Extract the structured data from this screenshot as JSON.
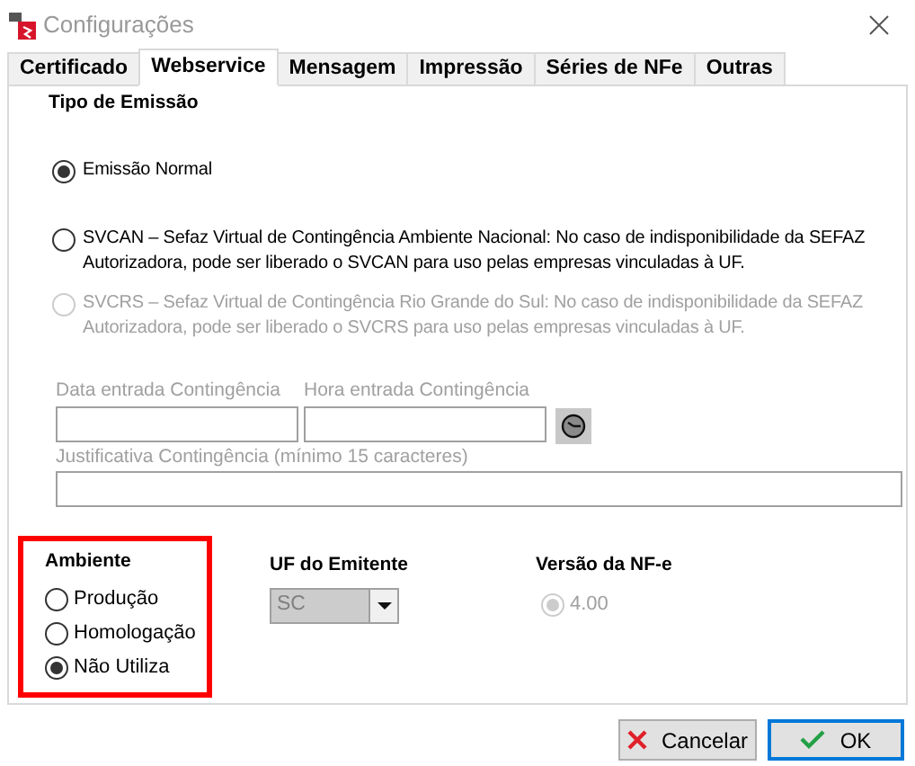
{
  "window": {
    "title": "Configurações"
  },
  "tabs": [
    {
      "label": "Certificado",
      "selected": false
    },
    {
      "label": "Webservice",
      "selected": true
    },
    {
      "label": "Mensagem",
      "selected": false
    },
    {
      "label": "Impressão",
      "selected": false
    },
    {
      "label": "Séries de NFe",
      "selected": false
    },
    {
      "label": "Outras",
      "selected": false
    }
  ],
  "tipo_emissao": {
    "title": "Tipo de Emissão",
    "options": [
      {
        "label": "Emissão Normal",
        "selected": true,
        "disabled": false
      },
      {
        "label": "SVCAN – Sefaz Virtual de Contingência Ambiente Nacional: No caso de indisponibilidade da SEFAZ Autorizadora, pode ser liberado o SVCAN para uso pelas empresas vinculadas à UF.",
        "selected": false,
        "disabled": false
      },
      {
        "label": "SVCRS – Sefaz Virtual de Contingência Rio Grande do Sul: No caso de indisponibilidade da SEFAZ Autorizadora, pode ser liberado o SVCRS para uso pelas empresas vinculadas à UF.",
        "selected": false,
        "disabled": true
      }
    ]
  },
  "contingencia": {
    "data_label": "Data entrada Contingência",
    "hora_label": "Hora entrada Contingência",
    "justificativa_label": "Justificativa Contingência (mínimo 15 caracteres)"
  },
  "ambiente": {
    "title": "Ambiente",
    "highlighted": true,
    "options": [
      {
        "label": "Produção",
        "selected": false
      },
      {
        "label": "Homologação",
        "selected": false
      },
      {
        "label": "Não Utiliza",
        "selected": true
      }
    ]
  },
  "uf": {
    "title": "UF do Emitente",
    "value": "SC",
    "disabled": true
  },
  "versao": {
    "title": "Versão da NF-e",
    "options": [
      {
        "label": "4.00",
        "selected": true,
        "disabled": true
      }
    ]
  },
  "buttons": [
    {
      "kind": "cancel",
      "label": "Cancelar",
      "default": false
    },
    {
      "kind": "ok",
      "label": "OK",
      "default": true
    }
  ]
}
